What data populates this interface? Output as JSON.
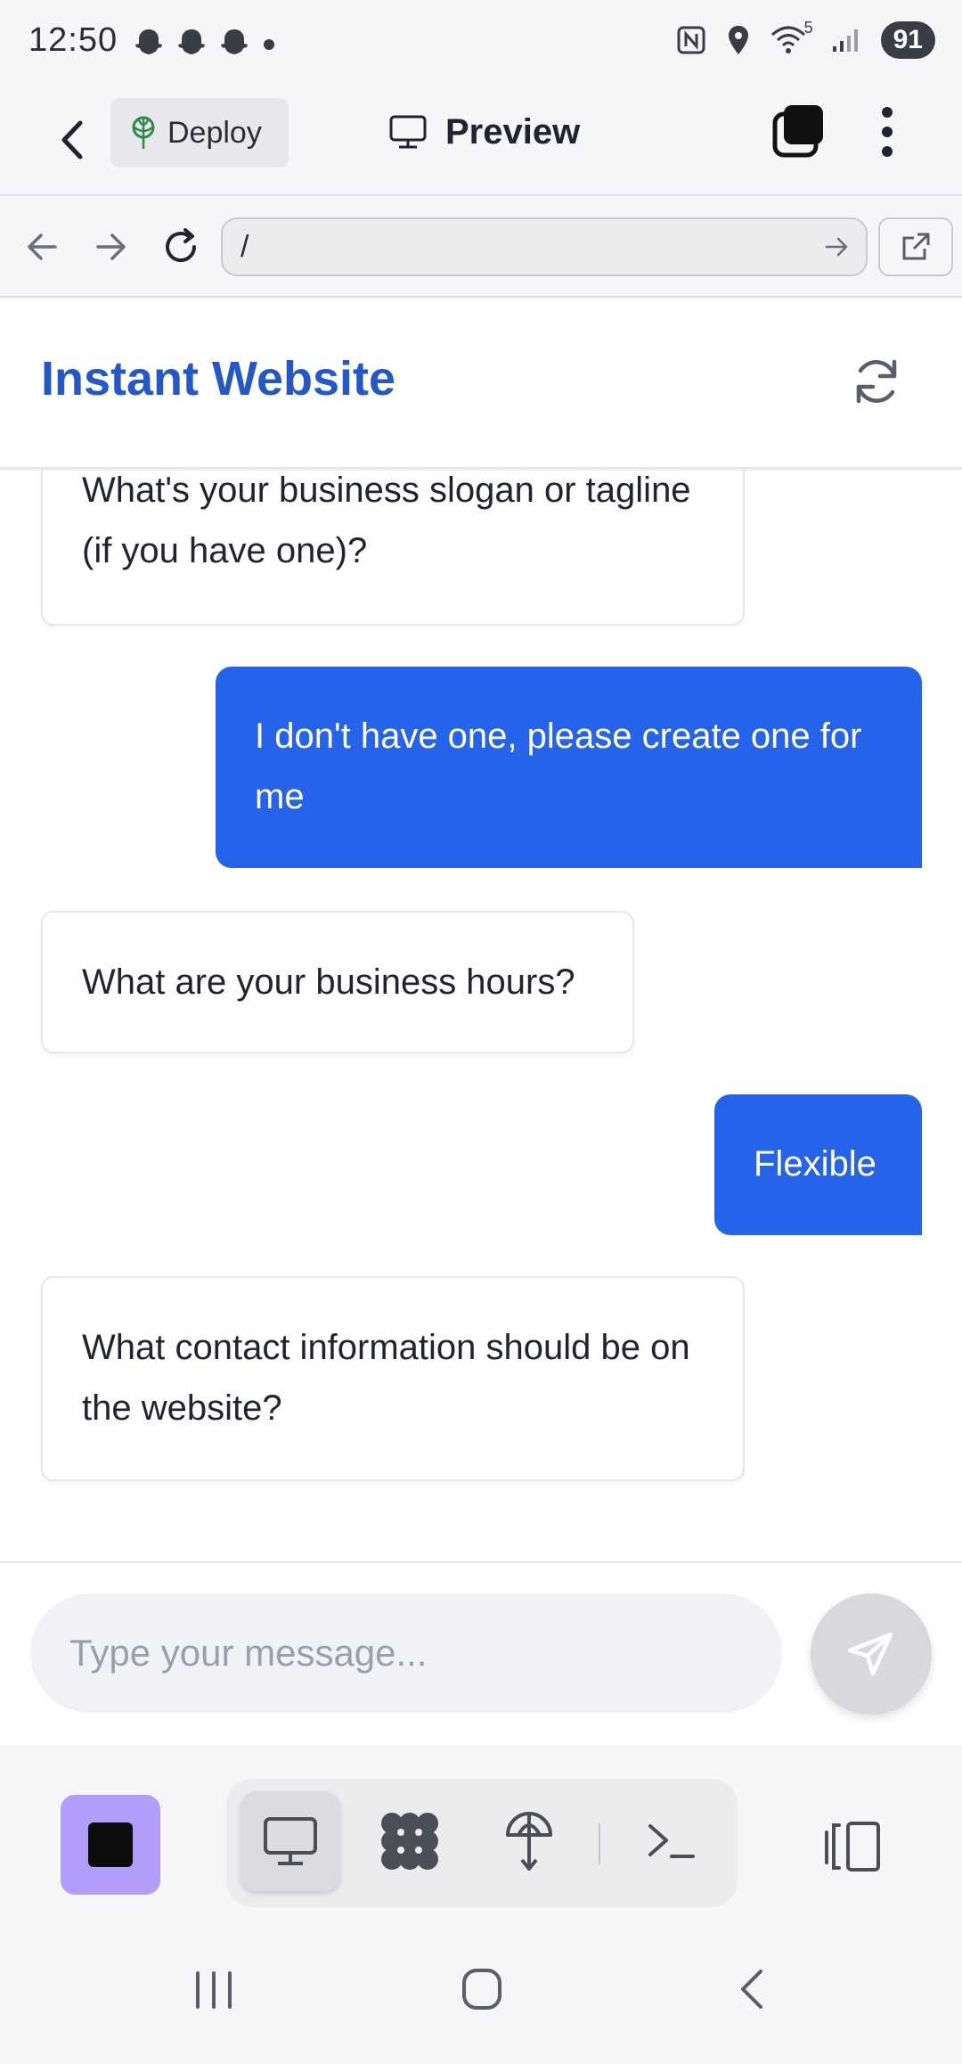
{
  "status_bar": {
    "time": "12:50",
    "battery": "91",
    "wifi_label": "5"
  },
  "app_bar": {
    "deploy_label": "Deploy",
    "preview_label": "Preview"
  },
  "browser": {
    "url": "/"
  },
  "site": {
    "title": "Instant Website"
  },
  "messages": [
    {
      "role": "bot",
      "text": "What's your business slogan or tagline (if you have one)?"
    },
    {
      "role": "user",
      "text": "I don't have one, please create one for me"
    },
    {
      "role": "bot",
      "text": "What are your business hours?"
    },
    {
      "role": "user",
      "text": "Flexible"
    },
    {
      "role": "bot",
      "text": "What contact information should be on the website?"
    }
  ],
  "input": {
    "placeholder": "Type your message..."
  },
  "colors": {
    "accent": "#2563eb",
    "title": "#2457c8",
    "stop": "#b39dfb"
  }
}
